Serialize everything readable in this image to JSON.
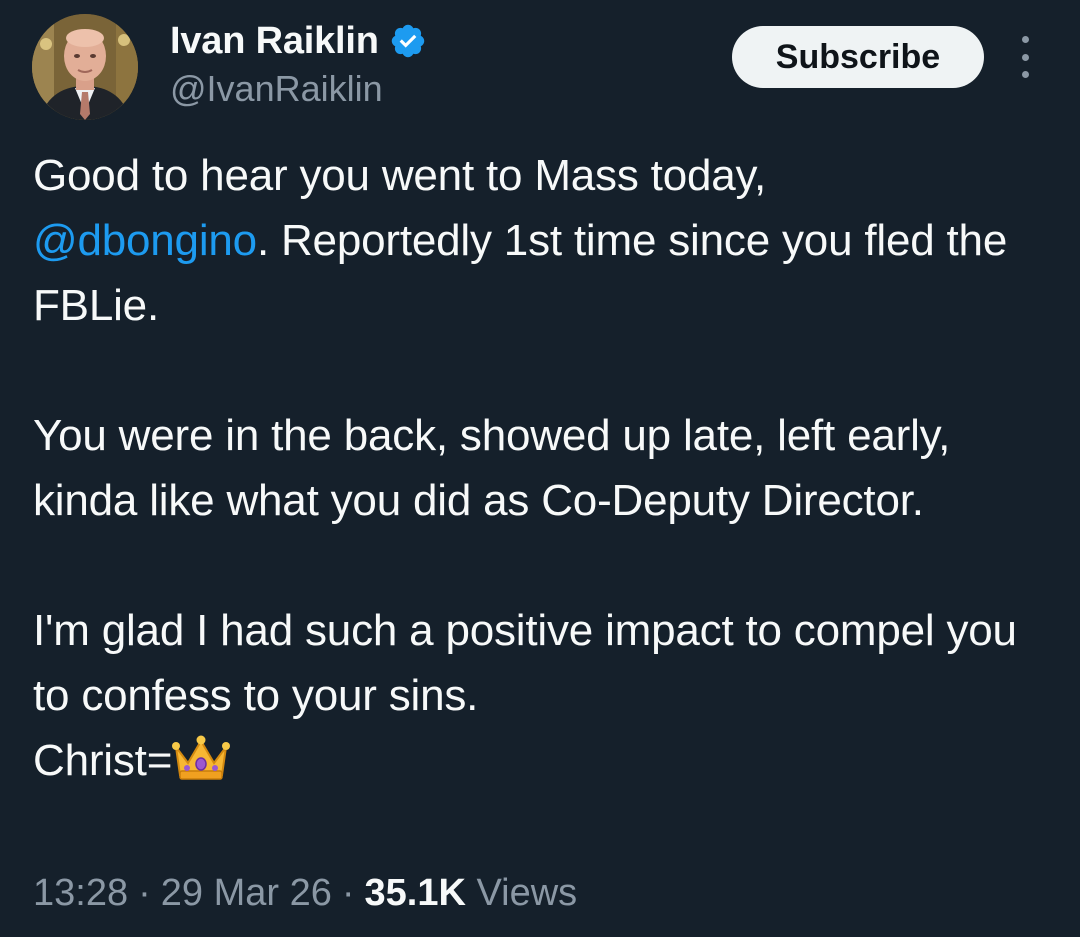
{
  "author": {
    "display_name": "Ivan Raiklin",
    "handle": "@IvanRaiklin",
    "verified_icon": "verified-badge-icon",
    "verified_color": "#1d9bf0"
  },
  "actions": {
    "subscribe_label": "Subscribe",
    "more_icon": "more-vertical-icon"
  },
  "tweet": {
    "p1_before": "Good to hear you went to Mass today,",
    "mention": "@dbongino",
    "p1_after": ". Reportedly 1st time since you fled the FBLie.",
    "p2": "You were in the back, showed up late, left early, kinda like what you did as Co-Deputy Director.",
    "p3": "I'm glad I had such a positive impact to compel you to confess to your sins.",
    "p4_text": "Christ=",
    "p4_emoji": "crown-icon"
  },
  "meta": {
    "time": "13:28",
    "separator": "·",
    "date": "29 Mar 26",
    "views_count": "35.1K",
    "views_label": "Views"
  },
  "colors": {
    "background": "#15202b",
    "text": "#f7f9f9",
    "secondary": "#8b98a5",
    "link": "#1d9bf0"
  }
}
